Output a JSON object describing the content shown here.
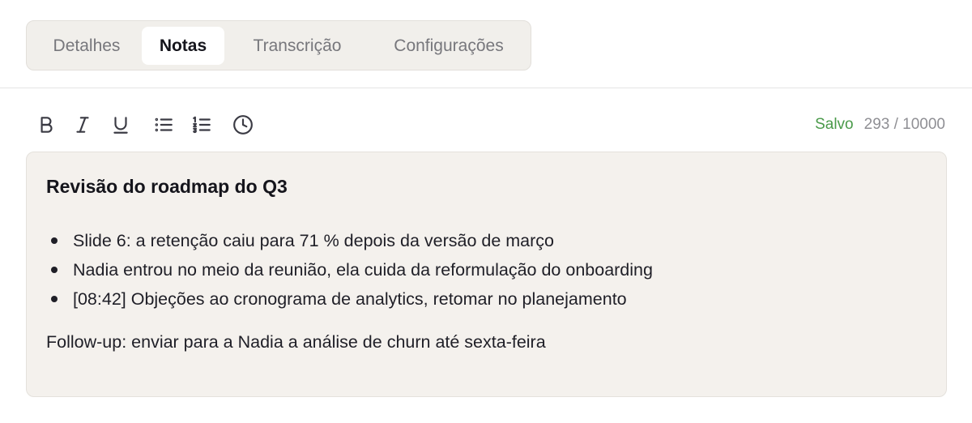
{
  "tabs": [
    {
      "label": "Detalhes",
      "active": false
    },
    {
      "label": "Notas",
      "active": true
    },
    {
      "label": "Transcrição",
      "active": false
    },
    {
      "label": "Configurações",
      "active": false
    }
  ],
  "toolbar": {
    "tools": [
      "bold-icon",
      "italic-icon",
      "underline-icon",
      "bullet-list-icon",
      "numbered-list-icon",
      "clock-icon"
    ]
  },
  "status": {
    "saved_label": "Salvo",
    "char_count": "293 / 10000"
  },
  "note": {
    "title": "Revisão do roadmap do Q3",
    "bullets": [
      "Slide 6: a retenção caiu para 71 % depois da versão de março",
      "Nadia entrou no meio da reunião, ela cuida da reformulação do onboarding",
      "[08:42] Objeções ao cronograma de analytics, retomar no planejamento"
    ],
    "followup": "Follow-up: enviar para a Nadia a análise de churn até sexta-feira"
  },
  "colors": {
    "accent_saved": "#4a9a4a",
    "editor_bg": "#f4f1ed",
    "tabs_bg": "#f1efeb"
  }
}
